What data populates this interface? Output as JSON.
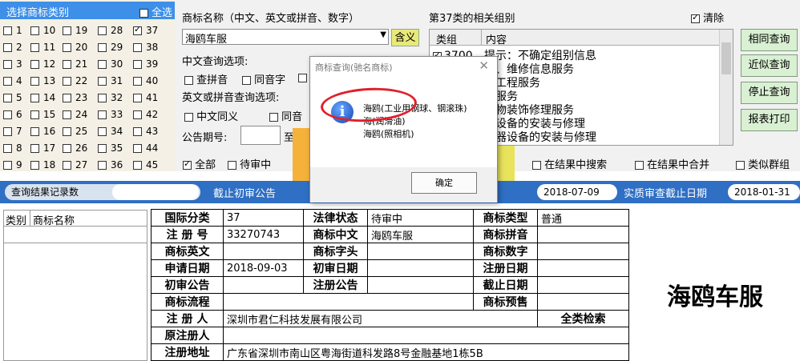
{
  "category_panel": {
    "title": "选择商标类别",
    "all_label": "全选",
    "categories": [
      {
        "n": "1",
        "on": false
      },
      {
        "n": "10",
        "on": false
      },
      {
        "n": "19",
        "on": false
      },
      {
        "n": "28",
        "on": false
      },
      {
        "n": "37",
        "on": true
      },
      {
        "n": "2",
        "on": false
      },
      {
        "n": "11",
        "on": false
      },
      {
        "n": "20",
        "on": false
      },
      {
        "n": "29",
        "on": false
      },
      {
        "n": "38",
        "on": false
      },
      {
        "n": "3",
        "on": false
      },
      {
        "n": "12",
        "on": false
      },
      {
        "n": "21",
        "on": false
      },
      {
        "n": "30",
        "on": false
      },
      {
        "n": "39",
        "on": false
      },
      {
        "n": "4",
        "on": false
      },
      {
        "n": "13",
        "on": false
      },
      {
        "n": "22",
        "on": false
      },
      {
        "n": "31",
        "on": false
      },
      {
        "n": "40",
        "on": false
      },
      {
        "n": "5",
        "on": false
      },
      {
        "n": "14",
        "on": false
      },
      {
        "n": "23",
        "on": false
      },
      {
        "n": "32",
        "on": false
      },
      {
        "n": "41",
        "on": false
      },
      {
        "n": "6",
        "on": false
      },
      {
        "n": "15",
        "on": false
      },
      {
        "n": "24",
        "on": false
      },
      {
        "n": "33",
        "on": false
      },
      {
        "n": "42",
        "on": false
      },
      {
        "n": "7",
        "on": false
      },
      {
        "n": "16",
        "on": false
      },
      {
        "n": "25",
        "on": false
      },
      {
        "n": "34",
        "on": false
      },
      {
        "n": "43",
        "on": false
      },
      {
        "n": "8",
        "on": false
      },
      {
        "n": "17",
        "on": false
      },
      {
        "n": "26",
        "on": false
      },
      {
        "n": "35",
        "on": false
      },
      {
        "n": "44",
        "on": false
      },
      {
        "n": "9",
        "on": false
      },
      {
        "n": "18",
        "on": false
      },
      {
        "n": "27",
        "on": false
      },
      {
        "n": "36",
        "on": false
      },
      {
        "n": "45",
        "on": false
      }
    ]
  },
  "search": {
    "name_label": "商标名称（中文、英文或拼音、数字）",
    "name_value": "海鸥车服",
    "meaning_button": "含义",
    "cn_options_label": "中文查询选项:",
    "pinyin": "查拼音",
    "homophone": "同音字",
    "en_options_label": "英文或拼音查询选项:",
    "cn_synonym": "中文同义",
    "homophone2": "同音",
    "period_label": "公告期号:",
    "to_label": "至"
  },
  "groups": {
    "title": "第37类的相关组别",
    "clear_label": "清除",
    "col_group": "类组",
    "col_content": "内容",
    "rows": [
      {
        "group": "3700",
        "text": "提示：不确定组别信息",
        "checked": true
      },
      {
        "group": "",
        "text": "设、维修信息服务",
        "checked": false
      },
      {
        "group": "",
        "text": "筑工程服务",
        "checked": false
      },
      {
        "group": "",
        "text": "采服务",
        "checked": false
      },
      {
        "group": "",
        "text": "筑物装饰修理服务",
        "checked": false
      },
      {
        "group": "",
        "text": "暖设备的安装与修理",
        "checked": false
      },
      {
        "group": "",
        "text": "电器设备的安装与修理",
        "checked": false
      }
    ]
  },
  "actions": {
    "same": "相同查询",
    "similar": "近似查询",
    "stop": "停止查询",
    "report": "报表打印"
  },
  "filters": {
    "all": "全部",
    "pending": "待审中",
    "in_results": "在结果中搜索",
    "merge_results": "在结果中合并",
    "similar_groups": "类似群组"
  },
  "status": {
    "count_label": "查询结果记录数",
    "count_value": "",
    "deadline_label": "截止初审公告",
    "date1": "2018-07-09",
    "real_deadline_label": "实质审查截止日期",
    "date2": "2018-01-31"
  },
  "list": {
    "col_class": "类别",
    "col_name": "商标名称"
  },
  "detail": {
    "intl_class_label": "国际分类",
    "intl_class": "37",
    "legal_status_label": "法律状态",
    "legal_status": "待审中",
    "type_label": "商标类型",
    "type": "普通",
    "reg_no_label": "注 册 号",
    "reg_no": "33270743",
    "cn_label": "商标中文",
    "cn": "海鸥车服",
    "pinyin_label": "商标拼音",
    "pinyin": "",
    "en_label": "商标英文",
    "en": "",
    "head_label": "商标字头",
    "head": "",
    "digit_label": "商标数字",
    "digit": "",
    "apply_date_label": "申请日期",
    "apply_date": "2018-09-03",
    "first_date_label": "初审日期",
    "first_date": "",
    "reg_date_label": "注册日期",
    "reg_date": "",
    "first_notice_label": "初审公告",
    "first_notice": "",
    "reg_notice_label": "注册公告",
    "reg_notice": "",
    "deadline_label": "截止日期",
    "deadline": "",
    "flow_label": "商标流程",
    "flow": "",
    "preview_label": "商标预售",
    "preview": "",
    "registrant_label": "注 册 人",
    "registrant": "深圳市君仁科技发展有限公司",
    "all_class_search": "全类检索",
    "orig_registrant_label": "原注册人",
    "orig_registrant": "",
    "address_label": "注册地址",
    "address": "广东省深圳市南山区粤海街道科发路8号金融基地1栋5B"
  },
  "big_name": "海鸥车服",
  "dialog": {
    "title": "商标查询(驰名商标)",
    "lines": [
      "海鸥(工业用钢球、钢滚珠)",
      "海(润滑油)",
      "海鸥(照相机)"
    ],
    "ok": "确定"
  }
}
